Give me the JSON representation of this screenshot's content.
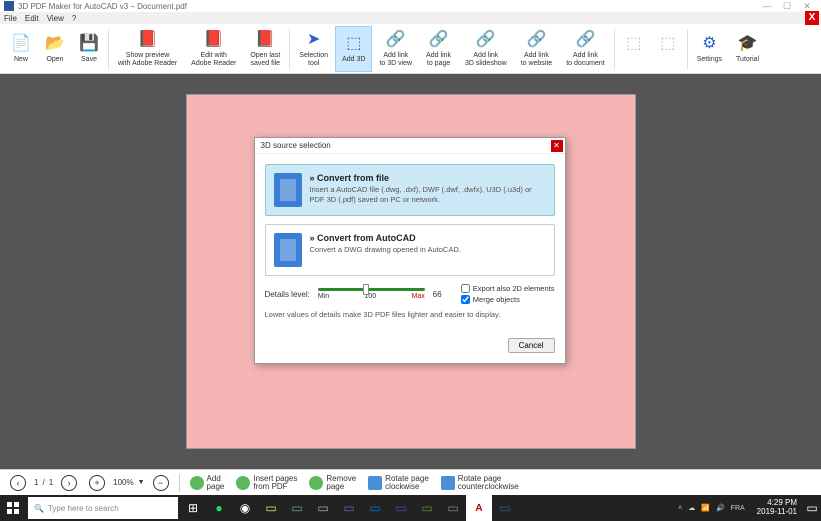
{
  "window": {
    "title": "3D PDF Maker for AutoCAD v3 – Document.pdf"
  },
  "menu": {
    "file": "File",
    "edit": "Edit",
    "view": "View",
    "help": "?"
  },
  "toolbar": {
    "new": "New",
    "open": "Open",
    "save": "Save",
    "preview": "Show preview\nwith Adobe Reader",
    "editwith": "Edit with\nAdobe Reader",
    "openlast": "Open last\nsaved file",
    "seltool": "Selection\ntool",
    "add3d": "Add 3D",
    "addlink3d": "Add link\nto 3D view",
    "addlinkpage": "Add link\nto page",
    "addlinkslide": "Add link\n3D slideshow",
    "addlinkweb": "Add link\nto website",
    "addlinkdoc": "Add link\nto document",
    "settings": "Settings",
    "tutorial": "Tutorial"
  },
  "dialog": {
    "title": "3D source selection",
    "opt1_title": "Convert from file",
    "opt1_desc": "Insert a AutoCAD file (.dwg, .dxf), DWF (.dwf, .dwfx), U3D (.u3d) or PDF 3D (.pdf) saved on PC or network.",
    "opt2_title": "Convert from AutoCAD",
    "opt2_desc": "Convert a DWG drawing opened in AutoCAD.",
    "details_label": "Details level:",
    "slider_min": "Min",
    "slider_mid": "100",
    "slider_max": "Max",
    "slider_value": "66",
    "chk_export": "Export also 2D elements",
    "chk_merge": "Merge objects",
    "hint": "Lower values of details make 3D PDF files lighter and easier to display.",
    "cancel": "Cancel"
  },
  "bottombar": {
    "page_current": "1",
    "page_sep": "/",
    "page_total": "1",
    "zoom": "100%",
    "addpage": "Add\npage",
    "insertpages": "Insert pages\nfrom PDF",
    "removepage": "Remove\npage",
    "rotcw": "Rotate page\nclockwise",
    "rotccw": "Rotate page\ncounterclockwise"
  },
  "taskbar": {
    "search_placeholder": "Type here to search",
    "lang": "FRA",
    "time": "4:29 PM",
    "date": "2019-11-01"
  }
}
